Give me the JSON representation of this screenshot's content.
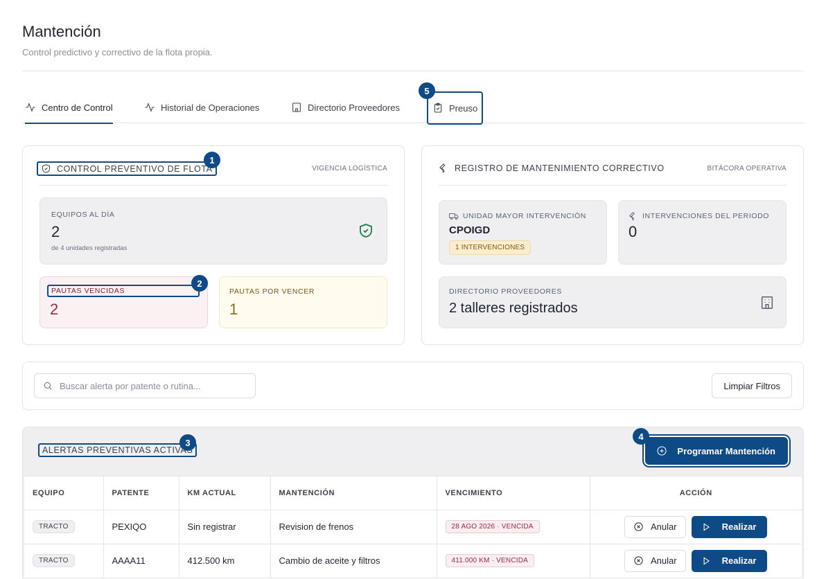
{
  "header": {
    "title": "Mantención",
    "subtitle": "Control predictivo y correctivo de la flota propia."
  },
  "tabs": [
    {
      "label": "Centro de Control",
      "icon": "activity-icon"
    },
    {
      "label": "Historial de Operaciones",
      "icon": "activity-icon"
    },
    {
      "label": "Directorio Proveedores",
      "icon": "building-icon"
    },
    {
      "label": "Preuso",
      "icon": "clipboard-check-icon"
    }
  ],
  "callouts": [
    "1",
    "2",
    "3",
    "4",
    "5"
  ],
  "preventive": {
    "title": "Control Preventivo de Flota",
    "meta": "Vigencia Logística",
    "equipos_label": "Equipos al día",
    "equipos_value": "2",
    "equipos_sub": "de 4 unidades registradas",
    "vencidas_label": "Pautas vencidas",
    "vencidas_value": "2",
    "por_vencer_label": "Pautas por vencer",
    "por_vencer_value": "1"
  },
  "corrective": {
    "title": "Registro de Mantenimiento Correctivo",
    "meta": "Bitácora Operativa",
    "unidad_label": "Unidad mayor intervención",
    "unidad_value": "CPOIGD",
    "unidad_chip": "1 INTERVENCIONES",
    "interv_label": "Intervenciones del periodo",
    "interv_value": "0",
    "proveedores_label": "Directorio Proveedores",
    "proveedores_value": "2 talleres registrados"
  },
  "search": {
    "placeholder": "Buscar alerta por patente o rutina...",
    "clear_label": "Limpiar Filtros"
  },
  "alerts": {
    "title": "Alertas Preventivas Activas",
    "program_label": "Programar Mantención",
    "columns": [
      "Equipo",
      "Patente",
      "KM Actual",
      "Mantención",
      "Vencimiento",
      "Acción"
    ],
    "rows": [
      {
        "equipo": "TRACTO",
        "patente": "PEXIQO",
        "km": "Sin registrar",
        "mantencion": "Revision de frenos",
        "vencimiento": "28 AGO 2026 · VENCIDA"
      },
      {
        "equipo": "TRACTO",
        "patente": "AAAA11",
        "km": "412.500 km",
        "mantencion": "Cambio de aceite y filtros",
        "vencimiento": "411.000 KM · VENCIDA"
      }
    ],
    "anular_label": "Anular",
    "realizar_label": "Realizar"
  },
  "colors": {
    "primary": "#0d4a86",
    "danger": "#a02a48",
    "warning": "#8a6b1f",
    "success": "#1d7a43"
  }
}
